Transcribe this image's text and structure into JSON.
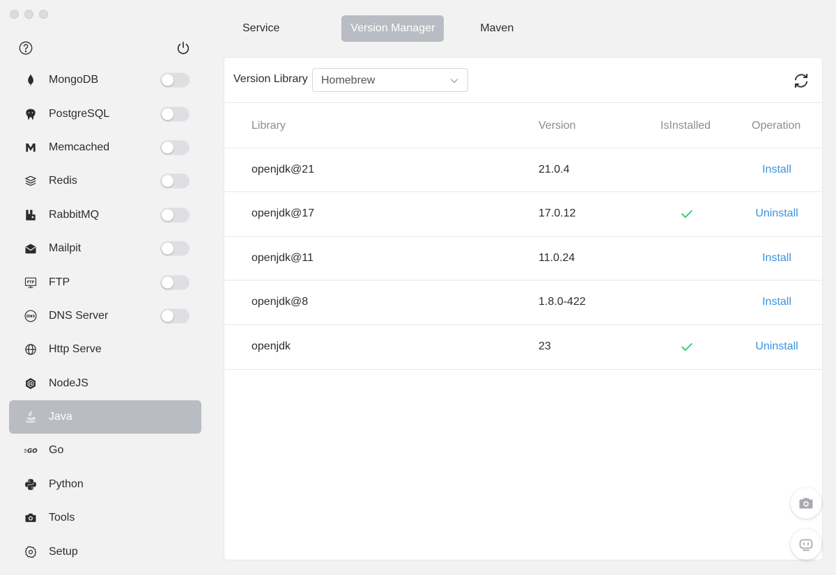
{
  "sidebar": {
    "items": [
      {
        "label": "MongoDB",
        "icon": "mongodb-icon",
        "toggle": true,
        "enabled": false
      },
      {
        "label": "PostgreSQL",
        "icon": "postgresql-icon",
        "toggle": true,
        "enabled": false
      },
      {
        "label": "Memcached",
        "icon": "memcached-icon",
        "toggle": true,
        "enabled": false
      },
      {
        "label": "Redis",
        "icon": "redis-icon",
        "toggle": true,
        "enabled": false
      },
      {
        "label": "RabbitMQ",
        "icon": "rabbitmq-icon",
        "toggle": true,
        "enabled": false
      },
      {
        "label": "Mailpit",
        "icon": "mailpit-icon",
        "toggle": true,
        "enabled": false
      },
      {
        "label": "FTP",
        "icon": "ftp-icon",
        "toggle": true,
        "enabled": false
      },
      {
        "label": "DNS Server",
        "icon": "dns-icon",
        "toggle": true,
        "enabled": false
      },
      {
        "label": "Http Serve",
        "icon": "globe-icon",
        "toggle": false
      },
      {
        "label": "NodeJS",
        "icon": "nodejs-icon",
        "toggle": false
      },
      {
        "label": "Java",
        "icon": "java-icon",
        "toggle": false,
        "active": true
      },
      {
        "label": "Go",
        "icon": "go-icon",
        "toggle": false
      },
      {
        "label": "Python",
        "icon": "python-icon",
        "toggle": false
      },
      {
        "label": "Tools",
        "icon": "toolbox-icon",
        "toggle": false
      },
      {
        "label": "Setup",
        "icon": "gear-icon",
        "toggle": false
      }
    ]
  },
  "tabs": [
    {
      "label": "Service",
      "active": false
    },
    {
      "label": "Version Manager",
      "active": true
    },
    {
      "label": "Maven",
      "active": false
    }
  ],
  "toolbar": {
    "library_label": "Version Library",
    "library_value": "Homebrew"
  },
  "table": {
    "headers": {
      "library": "Library",
      "version": "Version",
      "installed": "IsInstalled",
      "operation": "Operation"
    },
    "rows": [
      {
        "library": "openjdk@21",
        "version": "21.0.4",
        "installed": false,
        "operation": "Install"
      },
      {
        "library": "openjdk@17",
        "version": "17.0.12",
        "installed": true,
        "operation": "Uninstall"
      },
      {
        "library": "openjdk@11",
        "version": "11.0.24",
        "installed": false,
        "operation": "Install"
      },
      {
        "library": "openjdk@8",
        "version": "1.8.0-422",
        "installed": false,
        "operation": "Install"
      },
      {
        "library": "openjdk",
        "version": "23",
        "installed": true,
        "operation": "Uninstall"
      }
    ]
  },
  "colors": {
    "accent": "#3b92e0",
    "check": "#2ecc71",
    "active_bg": "#b9bcc2"
  }
}
